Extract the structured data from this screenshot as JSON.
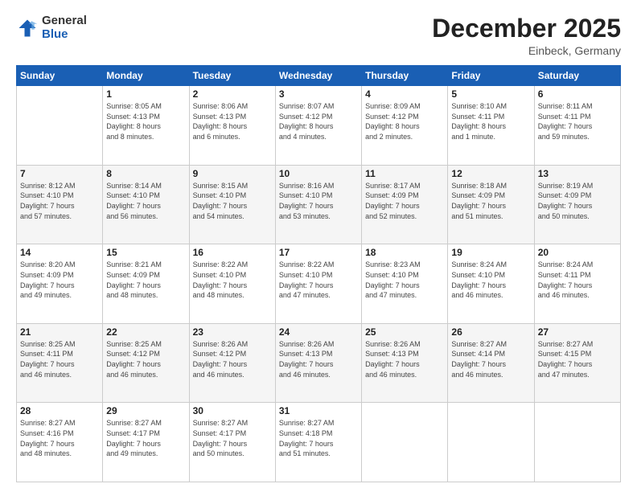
{
  "logo": {
    "general": "General",
    "blue": "Blue"
  },
  "header": {
    "month": "December 2025",
    "location": "Einbeck, Germany"
  },
  "weekdays": [
    "Sunday",
    "Monday",
    "Tuesday",
    "Wednesday",
    "Thursday",
    "Friday",
    "Saturday"
  ],
  "weeks": [
    [
      {
        "day": "",
        "info": ""
      },
      {
        "day": "1",
        "info": "Sunrise: 8:05 AM\nSunset: 4:13 PM\nDaylight: 8 hours\nand 8 minutes."
      },
      {
        "day": "2",
        "info": "Sunrise: 8:06 AM\nSunset: 4:13 PM\nDaylight: 8 hours\nand 6 minutes."
      },
      {
        "day": "3",
        "info": "Sunrise: 8:07 AM\nSunset: 4:12 PM\nDaylight: 8 hours\nand 4 minutes."
      },
      {
        "day": "4",
        "info": "Sunrise: 8:09 AM\nSunset: 4:12 PM\nDaylight: 8 hours\nand 2 minutes."
      },
      {
        "day": "5",
        "info": "Sunrise: 8:10 AM\nSunset: 4:11 PM\nDaylight: 8 hours\nand 1 minute."
      },
      {
        "day": "6",
        "info": "Sunrise: 8:11 AM\nSunset: 4:11 PM\nDaylight: 7 hours\nand 59 minutes."
      }
    ],
    [
      {
        "day": "7",
        "info": "Sunrise: 8:12 AM\nSunset: 4:10 PM\nDaylight: 7 hours\nand 57 minutes."
      },
      {
        "day": "8",
        "info": "Sunrise: 8:14 AM\nSunset: 4:10 PM\nDaylight: 7 hours\nand 56 minutes."
      },
      {
        "day": "9",
        "info": "Sunrise: 8:15 AM\nSunset: 4:10 PM\nDaylight: 7 hours\nand 54 minutes."
      },
      {
        "day": "10",
        "info": "Sunrise: 8:16 AM\nSunset: 4:10 PM\nDaylight: 7 hours\nand 53 minutes."
      },
      {
        "day": "11",
        "info": "Sunrise: 8:17 AM\nSunset: 4:09 PM\nDaylight: 7 hours\nand 52 minutes."
      },
      {
        "day": "12",
        "info": "Sunrise: 8:18 AM\nSunset: 4:09 PM\nDaylight: 7 hours\nand 51 minutes."
      },
      {
        "day": "13",
        "info": "Sunrise: 8:19 AM\nSunset: 4:09 PM\nDaylight: 7 hours\nand 50 minutes."
      }
    ],
    [
      {
        "day": "14",
        "info": "Sunrise: 8:20 AM\nSunset: 4:09 PM\nDaylight: 7 hours\nand 49 minutes."
      },
      {
        "day": "15",
        "info": "Sunrise: 8:21 AM\nSunset: 4:09 PM\nDaylight: 7 hours\nand 48 minutes."
      },
      {
        "day": "16",
        "info": "Sunrise: 8:22 AM\nSunset: 4:10 PM\nDaylight: 7 hours\nand 48 minutes."
      },
      {
        "day": "17",
        "info": "Sunrise: 8:22 AM\nSunset: 4:10 PM\nDaylight: 7 hours\nand 47 minutes."
      },
      {
        "day": "18",
        "info": "Sunrise: 8:23 AM\nSunset: 4:10 PM\nDaylight: 7 hours\nand 47 minutes."
      },
      {
        "day": "19",
        "info": "Sunrise: 8:24 AM\nSunset: 4:10 PM\nDaylight: 7 hours\nand 46 minutes."
      },
      {
        "day": "20",
        "info": "Sunrise: 8:24 AM\nSunset: 4:11 PM\nDaylight: 7 hours\nand 46 minutes."
      }
    ],
    [
      {
        "day": "21",
        "info": "Sunrise: 8:25 AM\nSunset: 4:11 PM\nDaylight: 7 hours\nand 46 minutes."
      },
      {
        "day": "22",
        "info": "Sunrise: 8:25 AM\nSunset: 4:12 PM\nDaylight: 7 hours\nand 46 minutes."
      },
      {
        "day": "23",
        "info": "Sunrise: 8:26 AM\nSunset: 4:12 PM\nDaylight: 7 hours\nand 46 minutes."
      },
      {
        "day": "24",
        "info": "Sunrise: 8:26 AM\nSunset: 4:13 PM\nDaylight: 7 hours\nand 46 minutes."
      },
      {
        "day": "25",
        "info": "Sunrise: 8:26 AM\nSunset: 4:13 PM\nDaylight: 7 hours\nand 46 minutes."
      },
      {
        "day": "26",
        "info": "Sunrise: 8:27 AM\nSunset: 4:14 PM\nDaylight: 7 hours\nand 46 minutes."
      },
      {
        "day": "27",
        "info": "Sunrise: 8:27 AM\nSunset: 4:15 PM\nDaylight: 7 hours\nand 47 minutes."
      }
    ],
    [
      {
        "day": "28",
        "info": "Sunrise: 8:27 AM\nSunset: 4:16 PM\nDaylight: 7 hours\nand 48 minutes."
      },
      {
        "day": "29",
        "info": "Sunrise: 8:27 AM\nSunset: 4:17 PM\nDaylight: 7 hours\nand 49 minutes."
      },
      {
        "day": "30",
        "info": "Sunrise: 8:27 AM\nSunset: 4:17 PM\nDaylight: 7 hours\nand 50 minutes."
      },
      {
        "day": "31",
        "info": "Sunrise: 8:27 AM\nSunset: 4:18 PM\nDaylight: 7 hours\nand 51 minutes."
      },
      {
        "day": "",
        "info": ""
      },
      {
        "day": "",
        "info": ""
      },
      {
        "day": "",
        "info": ""
      }
    ]
  ]
}
